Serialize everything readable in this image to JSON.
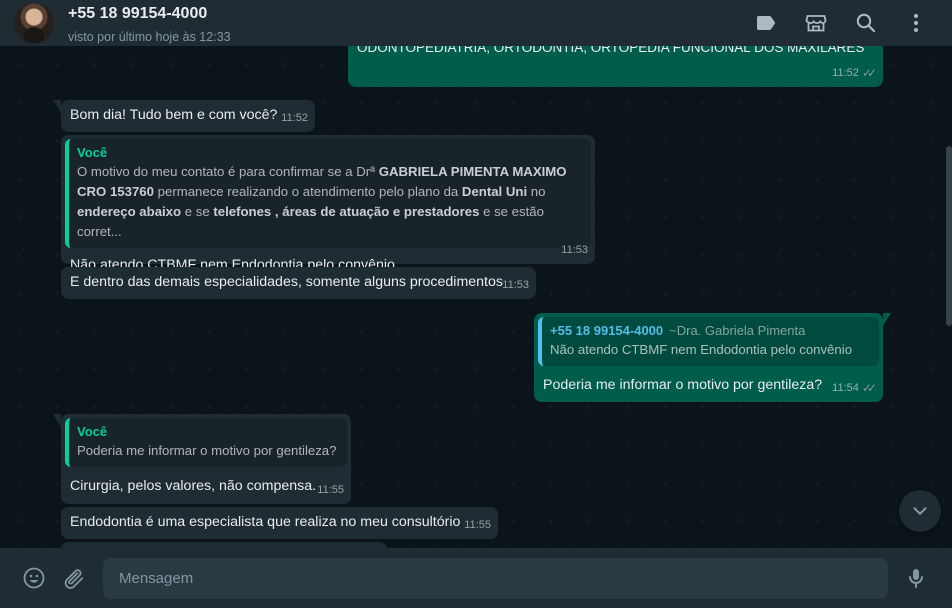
{
  "header": {
    "contact_name": "+55 18 99154-4000",
    "status": "visto por último hoje às 12:33",
    "icons": [
      "label-icon",
      "store-icon",
      "search-icon",
      "menu-icon"
    ]
  },
  "messages": [
    {
      "text": "ODONTOPEDIATRIA, ORTODONTIA, ORTOPEDIA FUNCIONAL DOS MAXILARES",
      "time": "11:52",
      "direction": "out",
      "status": "read"
    },
    {
      "text": "Bom dia! Tudo bem e com você?",
      "time": "11:52",
      "direction": "in"
    },
    {
      "direction": "in",
      "quote": {
        "author": "Você",
        "line1_pre": "O motivo do meu contato é para confirmar se a Drª ",
        "line1_bold": "GABRIELA PIMENTA MAXIMO",
        "line2_bold": "CRO 153760",
        "line2_mid": " permanece realizando o atendimento pelo plano da ",
        "line2_bold2": "Dental Uni",
        "line2_post": " no",
        "line3_bold": "endereço abaixo",
        "line3_mid": " e se ",
        "line3_bold2": "telefones , áreas de atuação e prestadores",
        "line3_post": " e se estão corret..."
      },
      "text": "Não atendo CTBMF nem Endodontia pelo convênio",
      "time": "11:53"
    },
    {
      "text": "E dentro das demais especialidades, somente alguns procedimentos",
      "time": "11:53",
      "direction": "in"
    },
    {
      "direction": "out",
      "quote": {
        "author": "+55 18 99154-4000",
        "alias": "~Dra. Gabriela Pimenta",
        "text": "Não atendo CTBMF nem Endodontia pelo convênio"
      },
      "text": "Poderia me informar o motivo por gentileza?",
      "time": "11:54",
      "status": "read"
    },
    {
      "direction": "in",
      "quote": {
        "author": "Você",
        "text": "Poderia me informar o motivo por gentileza?"
      },
      "text": "Cirurgia, pelos valores, não compensa.",
      "time": "11:55"
    },
    {
      "text": "Endodontia é uma especialista que realiza no meu consultório",
      "time": "11:55",
      "direction": "in"
    }
  ],
  "footer": {
    "placeholder": "Mensagem",
    "icons": [
      "emoji-icon",
      "attach-icon",
      "microphone-icon"
    ]
  },
  "colors": {
    "background": "#0b141a",
    "panel": "#202c33",
    "incoming_bubble": "#202c33",
    "outgoing_bubble": "#005c4b",
    "accent_green": "#06cf9c",
    "accent_blue": "#53bdeb"
  }
}
